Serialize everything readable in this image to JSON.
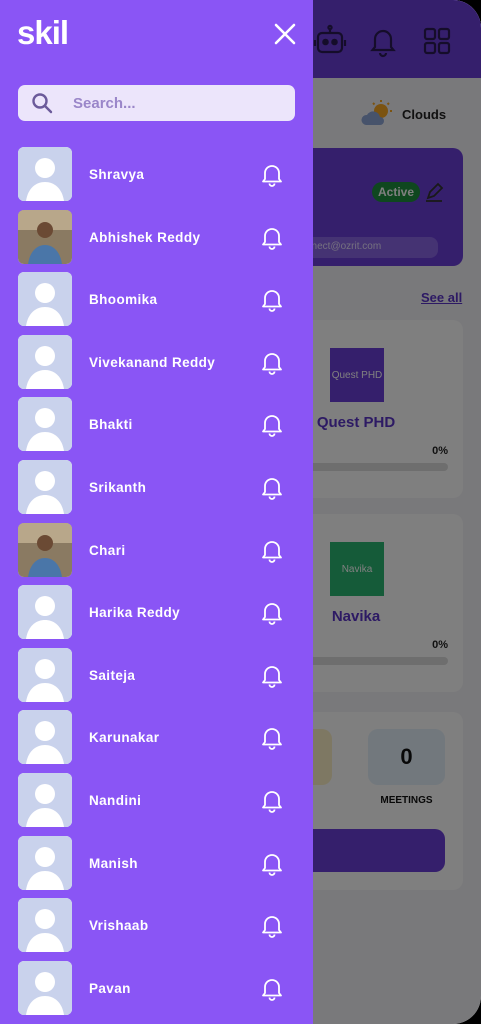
{
  "background_app": {
    "weather": {
      "label": "Clouds",
      "icon": "cloud-sun-icon"
    },
    "profile": {
      "status": "Active",
      "email_fragment": "nnect@ozrit.com"
    },
    "courses_header": {
      "see_all": "See all"
    },
    "courses": [
      {
        "thumb_label": "Quest PHD",
        "title": "Quest PHD",
        "progress": "0%",
        "thumb_color": "#6b3fd8"
      },
      {
        "thumb_label": "Navika",
        "title": "Navika",
        "progress": "0%",
        "thumb_color": "#2bb673"
      }
    ],
    "stats": {
      "meetings_value": "0",
      "meetings_label": "MEETINGS"
    },
    "header_icons": [
      "robot-icon",
      "bell-icon",
      "grid-icon"
    ]
  },
  "drawer": {
    "brand": "skil",
    "search": {
      "placeholder": "Search..."
    },
    "contacts": [
      {
        "name": "Shravya",
        "photo": "placeholder"
      },
      {
        "name": "Abhishek Reddy",
        "photo": "photo"
      },
      {
        "name": "Bhoomika",
        "photo": "placeholder"
      },
      {
        "name": "Vivekanand Reddy",
        "photo": "placeholder"
      },
      {
        "name": "Bhakti",
        "photo": "placeholder"
      },
      {
        "name": "Srikanth",
        "photo": "placeholder"
      },
      {
        "name": "Chari",
        "photo": "photo"
      },
      {
        "name": "Harika Reddy",
        "photo": "placeholder"
      },
      {
        "name": "Saiteja",
        "photo": "placeholder"
      },
      {
        "name": "Karunakar",
        "photo": "placeholder"
      },
      {
        "name": "Nandini",
        "photo": "placeholder"
      },
      {
        "name": "Manish",
        "photo": "placeholder"
      },
      {
        "name": "Vrishaab",
        "photo": "placeholder"
      },
      {
        "name": "Pavan",
        "photo": "placeholder"
      }
    ]
  },
  "colors": {
    "drawer_bg": "#8a55f5",
    "brand_purple": "#6b3fd8",
    "active_green": "#1e8e3e"
  }
}
